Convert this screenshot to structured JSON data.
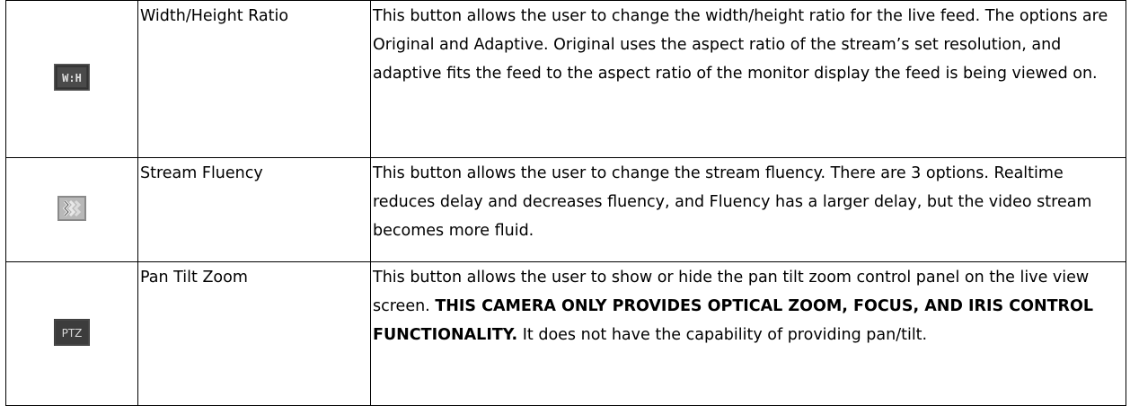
{
  "rows": [
    {
      "icon": "wh-ratio-icon",
      "name": "Width/Height Ratio",
      "desc_parts": [
        {
          "text": "This button allows the user to change the width/height ratio for the live feed. The options are Original and Adaptive. Original uses the aspect ratio of the stream’s set resolution, and adaptive fits the feed to the aspect ratio of the monitor display the feed is being viewed on.",
          "bold": false
        }
      ]
    },
    {
      "icon": "stream-fluency-icon",
      "name": "Stream Fluency",
      "desc_parts": [
        {
          "text": "This button allows the user to change the stream fluency. There are 3 options. Realtime reduces delay and decreases fluency, and Fluency has a larger delay, but the video stream becomes more fluid.",
          "bold": false
        }
      ]
    },
    {
      "icon": "ptz-icon",
      "name": "Pan Tilt Zoom",
      "desc_parts": [
        {
          "text": "This button allows the user to show or hide the pan tilt zoom control panel on the live view screen. ",
          "bold": false
        },
        {
          "text": "THIS CAMERA ONLY PROVIDES OPTICAL ZOOM, FOCUS, AND IRIS CONTROL FUNCTIONALITY.",
          "bold": true
        },
        {
          "text": " It does not have the capability of providing pan/tilt.",
          "bold": false
        }
      ]
    }
  ],
  "icon_labels": {
    "wh": "W:H",
    "ptz": "PTZ"
  },
  "colors": {
    "border": "#000000",
    "icon_bg": "#3c3c3c",
    "icon_text": "#d8d8d8"
  }
}
